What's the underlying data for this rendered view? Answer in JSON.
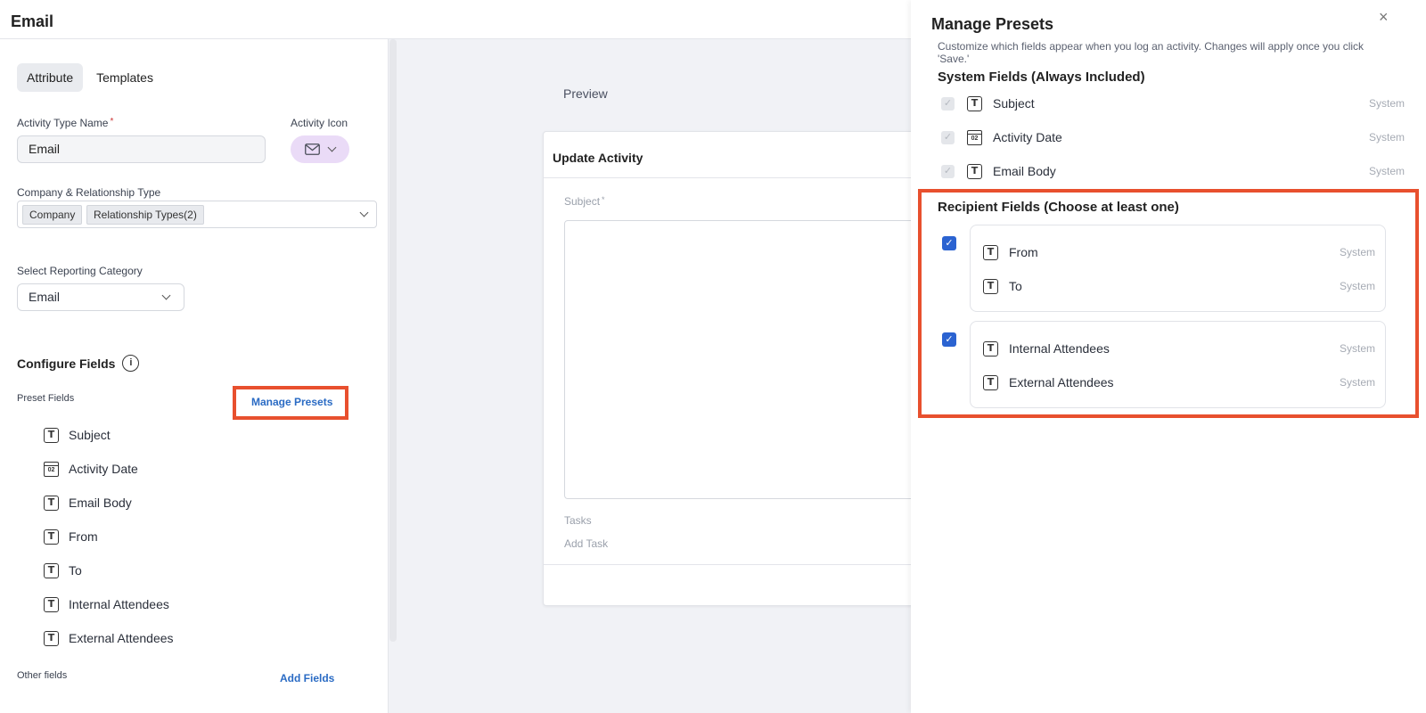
{
  "header": {
    "title": "Email"
  },
  "tabs": [
    {
      "label": "Attribute",
      "active": true
    },
    {
      "label": "Templates",
      "active": false
    }
  ],
  "form": {
    "activity_type_label": "Activity Type Name",
    "activity_type_value": "Email",
    "activity_icon_label": "Activity Icon",
    "company_rel_label": "Company & Relationship Type",
    "company_chip": "Company",
    "relationship_chip": "Relationship Types(2)",
    "reporting_label": "Select Reporting Category",
    "reporting_value": "Email"
  },
  "configure": {
    "title": "Configure Fields",
    "preset_label": "Preset Fields",
    "manage_presets": "Manage Presets",
    "preset_fields": [
      {
        "icon": "text-field-icon",
        "label": "Subject"
      },
      {
        "icon": "calendar-icon",
        "label": "Activity Date"
      },
      {
        "icon": "text-field-icon",
        "label": "Email Body"
      },
      {
        "icon": "text-field-icon",
        "label": "From"
      },
      {
        "icon": "text-field-icon",
        "label": "To"
      },
      {
        "icon": "text-field-icon",
        "label": "Internal Attendees"
      },
      {
        "icon": "text-field-icon",
        "label": "External Attendees"
      }
    ],
    "other_label": "Other fields",
    "add_fields": "Add Fields"
  },
  "preview": {
    "label": "Preview",
    "card_title": "Update Activity",
    "subject_label": "Subject",
    "tasks_label": "Tasks",
    "add_task": "Add Task"
  },
  "drawer": {
    "title": "Manage Presets",
    "close": "×",
    "description": "Customize which fields appear when you log an activity. Changes will apply once you click 'Save.'",
    "system_heading": "System Fields (Always Included)",
    "system_fields": [
      {
        "icon": "text-field-icon",
        "label": "Subject",
        "tag": "System"
      },
      {
        "icon": "calendar-icon",
        "label": "Activity Date",
        "tag": "System"
      },
      {
        "icon": "text-field-icon",
        "label": "Email Body",
        "tag": "System"
      }
    ],
    "recipient_heading": "Recipient Fields (Choose at least one)",
    "recipient_groups": [
      {
        "checked": true,
        "fields": [
          {
            "label": "From",
            "tag": "System"
          },
          {
            "label": "To",
            "tag": "System"
          }
        ]
      },
      {
        "checked": true,
        "fields": [
          {
            "label": "Internal Attendees",
            "tag": "System"
          },
          {
            "label": "External Attendees",
            "tag": "System"
          }
        ]
      }
    ]
  },
  "icons": {
    "calendar_day": "02",
    "text_glyph": "T",
    "check_glyph": "✓",
    "required_mark": "*",
    "info_glyph": "i"
  },
  "colors": {
    "accent": "#2b63d1",
    "link": "#2a6bc4",
    "highlight": "#e8502e",
    "icon_bg": "#eadbf7"
  }
}
